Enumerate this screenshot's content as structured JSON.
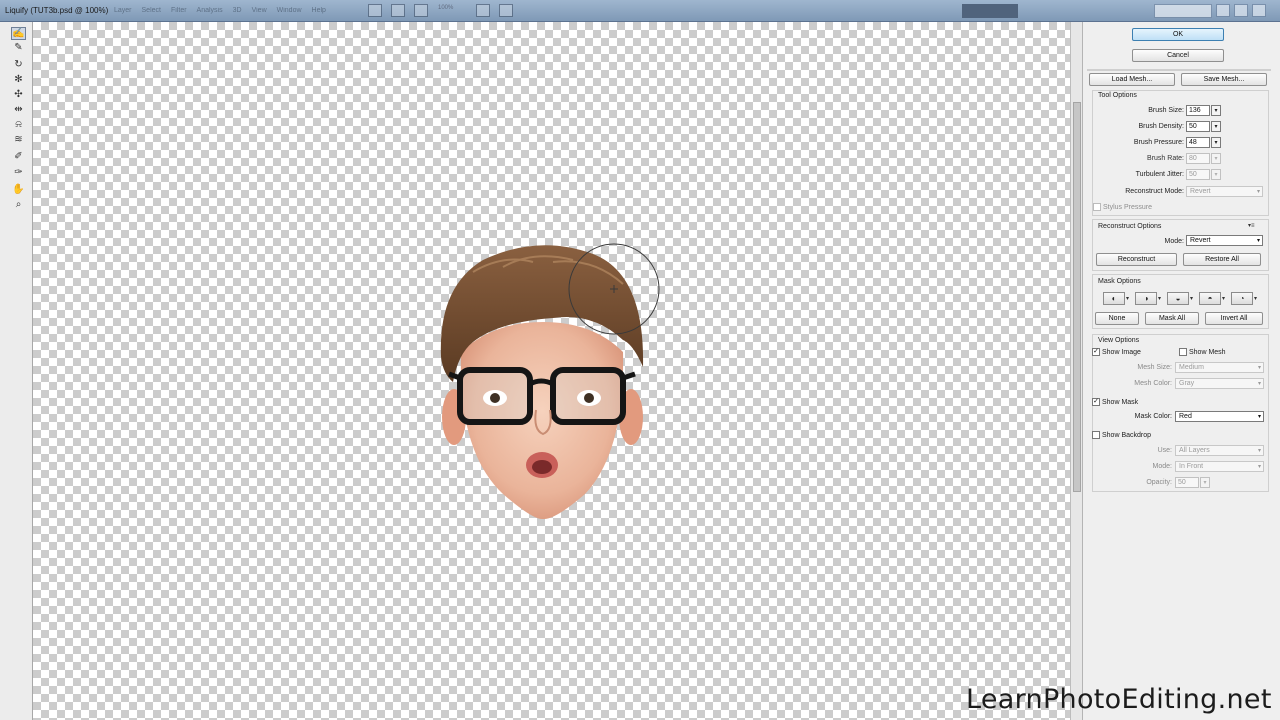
{
  "window": {
    "title": "Liquify (TUT3b.psd @ 100%)"
  },
  "app_menu": [
    "Layer",
    "Select",
    "Filter",
    "Analysis",
    "3D",
    "View",
    "Window",
    "Help"
  ],
  "zoom": "100%",
  "tools": [
    {
      "icon": "forward-warp-tool-icon",
      "glyph": "✍"
    },
    {
      "icon": "reconstruct-tool-icon",
      "glyph": "✎"
    },
    {
      "icon": "twirl-clockwise-tool-icon",
      "glyph": "↻"
    },
    {
      "icon": "pucker-tool-icon",
      "glyph": "✻"
    },
    {
      "icon": "bloat-tool-icon",
      "glyph": "✣"
    },
    {
      "icon": "push-left-tool-icon",
      "glyph": "⇹"
    },
    {
      "icon": "mirror-tool-icon",
      "glyph": "⍾"
    },
    {
      "icon": "turbulence-tool-icon",
      "glyph": "≋"
    },
    {
      "icon": "freeze-mask-tool-icon",
      "glyph": "✐"
    },
    {
      "icon": "thaw-mask-tool-icon",
      "glyph": "✑"
    },
    {
      "icon": "hand-tool-icon",
      "glyph": "✋"
    },
    {
      "icon": "zoom-tool-icon",
      "glyph": "⌕"
    }
  ],
  "buttons": {
    "ok": "OK",
    "cancel": "Cancel",
    "load_mesh": "Load Mesh...",
    "save_mesh": "Save Mesh...",
    "reconstruct": "Reconstruct",
    "restore_all": "Restore All",
    "none": "None",
    "mask_all": "Mask All",
    "invert_all": "Invert All"
  },
  "tool_options": {
    "heading": "Tool Options",
    "brush_size_label": "Brush Size:",
    "brush_size": "136",
    "brush_density_label": "Brush Density:",
    "brush_density": "50",
    "brush_pressure_label": "Brush Pressure:",
    "brush_pressure": "48",
    "brush_rate_label": "Brush Rate:",
    "brush_rate": "80",
    "turbulent_jitter_label": "Turbulent Jitter:",
    "turbulent_jitter": "50",
    "reconstruct_mode_label": "Reconstruct Mode:",
    "reconstruct_mode": "Revert",
    "stylus_pressure": "Stylus Pressure"
  },
  "reconstruct_options": {
    "heading": "Reconstruct Options",
    "mode_label": "Mode:",
    "mode": "Revert"
  },
  "mask_options": {
    "heading": "Mask Options"
  },
  "view_options": {
    "heading": "View Options",
    "show_image": "Show Image",
    "show_image_checked": "✓",
    "show_mesh": "Show Mesh",
    "mesh_size_label": "Mesh Size:",
    "mesh_size": "Medium",
    "mesh_color_label": "Mesh Color:",
    "mesh_color": "Gray",
    "show_mask": "Show Mask",
    "show_mask_checked": "✓",
    "mask_color_label": "Mask Color:",
    "mask_color": "Red",
    "show_backdrop": "Show Backdrop",
    "use_label": "Use:",
    "use": "All Layers",
    "mode_label": "Mode:",
    "mode": "In Front",
    "opacity_label": "Opacity:",
    "opacity": "50"
  },
  "watermark": "LearnPhotoEditing.net"
}
